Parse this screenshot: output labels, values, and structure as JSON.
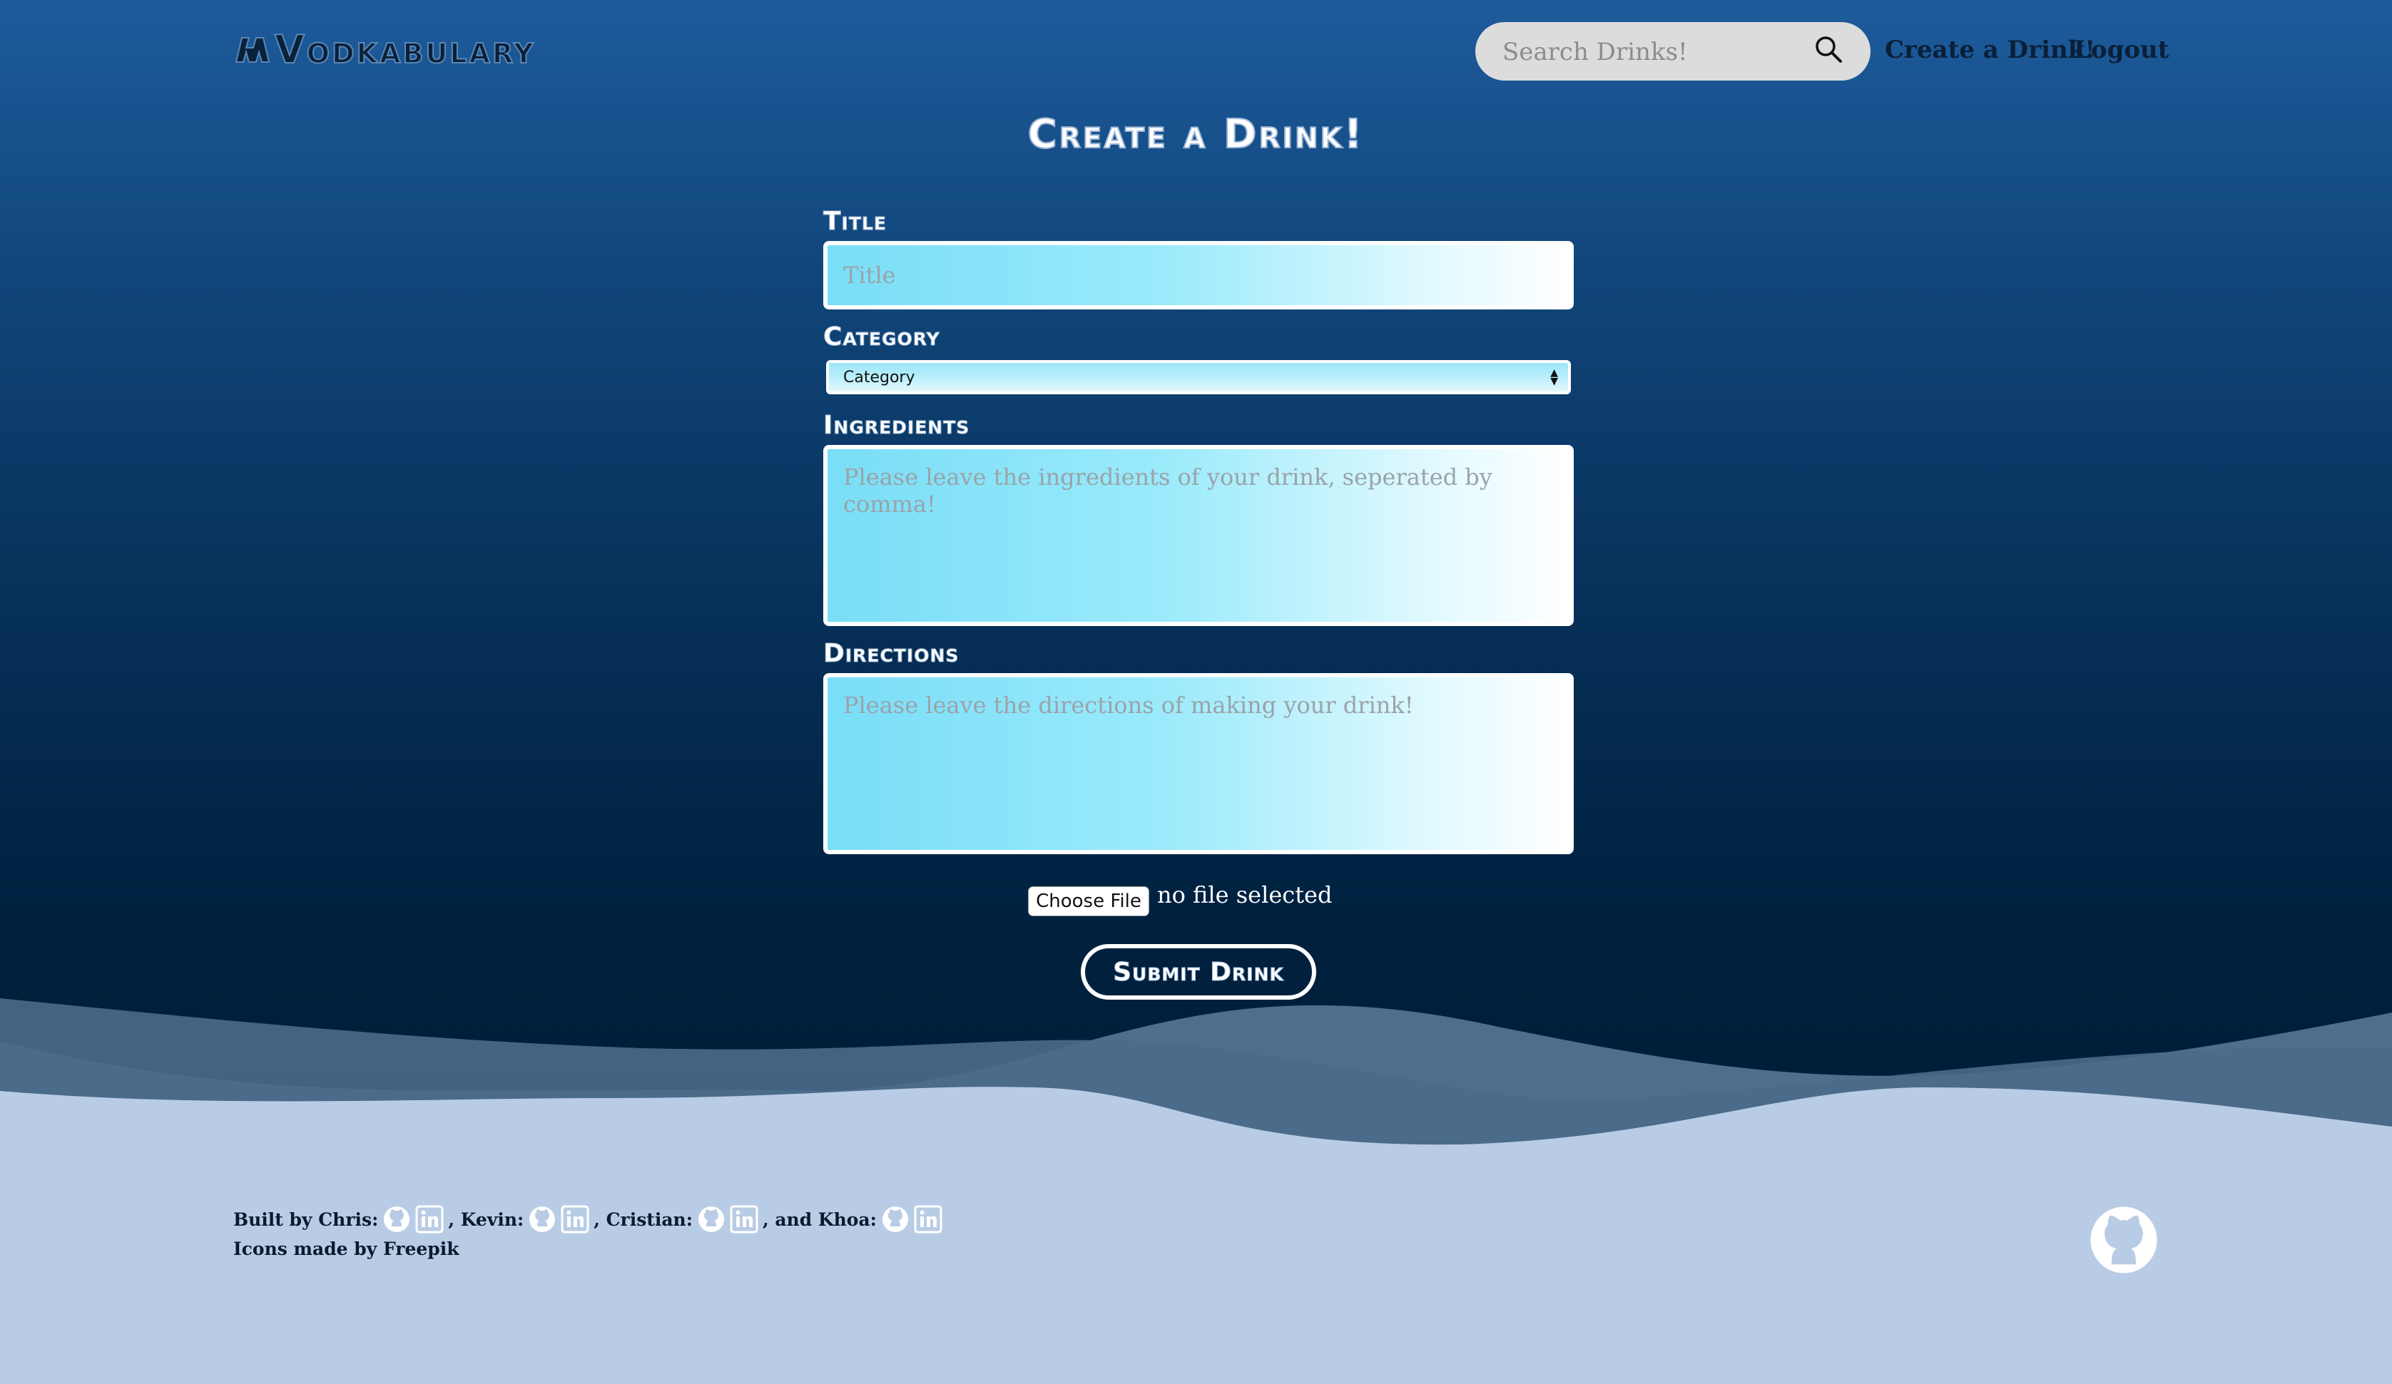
{
  "header": {
    "logo_text": "Vodkabulary",
    "search": {
      "placeholder": "Search Drinks!"
    },
    "nav": {
      "create_label": "Create a Drink!",
      "logout_label": "Logout"
    }
  },
  "form": {
    "page_title": "Create a Drink!",
    "title_label": "Title",
    "title_placeholder": "Title",
    "category_label": "Category",
    "category_selected": "Category",
    "ingredients_label": "Ingredients",
    "ingredients_placeholder": "Please leave the ingredients of your drink, seperated by comma!",
    "directions_label": "Directions",
    "directions_placeholder": "Please leave the directions of making your drink!",
    "file_button": "Choose File",
    "file_status": "no file selected",
    "submit_label": "Submit Drink"
  },
  "footer": {
    "built_by": "Built by Chris:",
    "kevin": ", Kevin:",
    "cristian": ", Cristian:",
    "khoa": ", and Khoa:",
    "icons_credit": "Icons made by Freepik"
  },
  "icons": [
    "github-icon",
    "linkedin-icon",
    "search-icon",
    "logo-icon"
  ],
  "colors": {
    "sky_top": "#1e5b9c",
    "sky_bottom": "#001c36",
    "footer_bg": "#b9cce5",
    "field_gradient_start": "#79def7",
    "field_gradient_end": "#ffffff"
  }
}
